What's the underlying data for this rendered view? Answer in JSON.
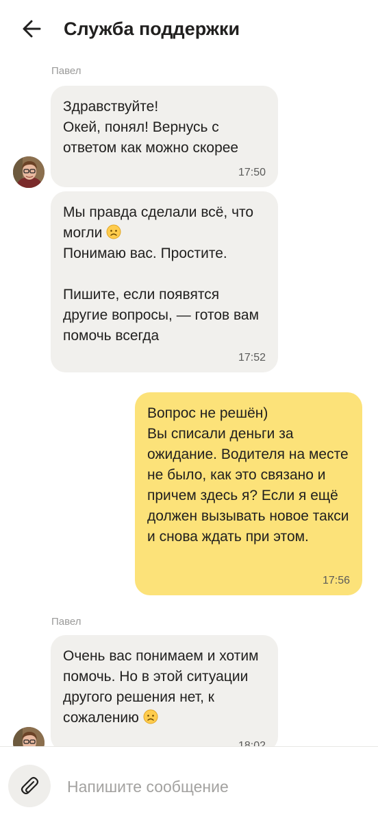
{
  "header": {
    "title": "Служба поддержки",
    "back_icon": "arrow-left-icon"
  },
  "messages": [
    {
      "direction": "incoming",
      "sender": "Павел",
      "text": "Здравствуйте!\nОкей, понял! Вернусь с ответом как можно скорее",
      "time": "17:50"
    },
    {
      "direction": "incoming",
      "sender": "",
      "text_before_emoji": "Мы правда сделали всё, что могли ",
      "emoji": "worried-face-icon",
      "text_after_emoji": "\nПонимаю вас. Простите.\n\nПишите, если появятся другие вопросы, — готов вам помочь всегда",
      "time": "17:52"
    },
    {
      "direction": "outgoing",
      "text": "Вопрос не решён)\nВы списали деньги за ожидание. Водителя на месте не было, как это связано и причем здесь я? Если я ещё должен вызывать новое такси и снова ждать при этом.",
      "time": "17:56"
    },
    {
      "direction": "incoming",
      "sender": "Павел",
      "text_before_emoji": "Очень вас понимаем и хотим помочь. Но в этой ситуации другого решения нет, к сожалению ",
      "emoji": "worried-face-icon",
      "time": "18:02"
    }
  ],
  "composer": {
    "placeholder": "Напишите сообщение",
    "attach_icon": "paperclip-icon"
  },
  "colors": {
    "incoming_bubble": "#f1f0ed",
    "outgoing_bubble": "#fce279",
    "sender_name": "#9a9a99",
    "placeholder": "#a3a2a0"
  }
}
